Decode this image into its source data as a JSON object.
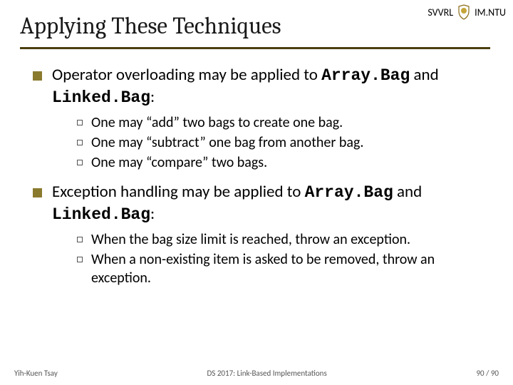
{
  "header": {
    "left_label": "SVVRL",
    "right_label": "IM.NTU"
  },
  "title": "Applying These Techniques",
  "body": {
    "item1": {
      "pre": "Operator overloading may be applied to ",
      "code1": "Array.Bag",
      "mid": " and ",
      "code2": "Linked.Bag",
      "post": ":",
      "sub1": "One may “add” two bags to create one bag.",
      "sub2": "One may “subtract” one bag from another bag.",
      "sub3": "One may “compare” two bags."
    },
    "item2": {
      "pre": "Exception handling may be applied to ",
      "code1": "Array.Bag",
      "mid": " and ",
      "code2": "Linked.Bag",
      "post": ":",
      "sub1": "When the bag size limit is reached, throw an exception.",
      "sub2": "When a non-existing item is asked to be removed, throw an exception."
    }
  },
  "footer": {
    "author": "Yih-Kuen Tsay",
    "center": "DS 2017: Link-Based Implementations",
    "page": "90 / 90"
  }
}
